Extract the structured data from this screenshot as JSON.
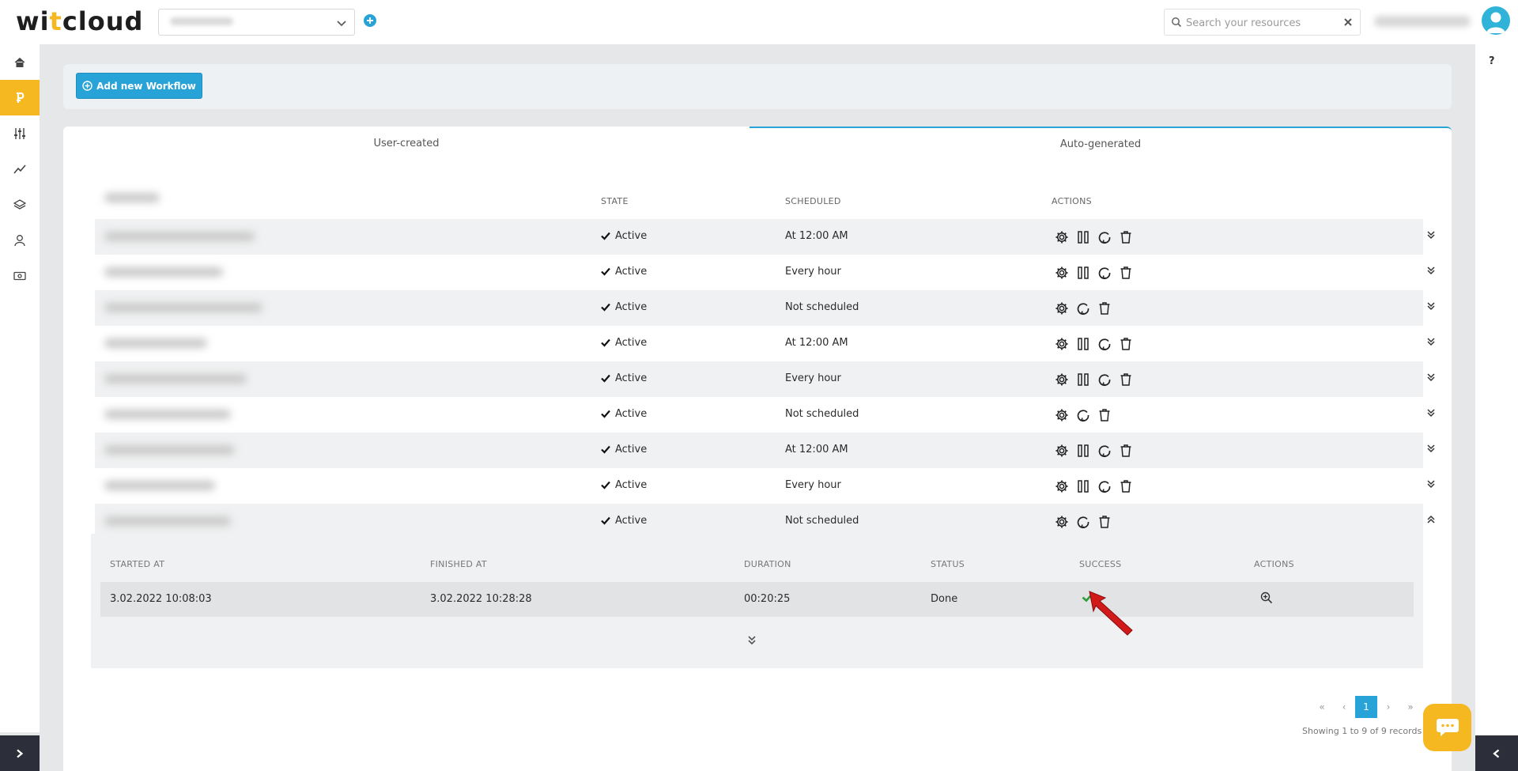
{
  "app": {
    "logo_text_a": "wi",
    "logo_text_b": "t",
    "logo_text_c": "cloud"
  },
  "search": {
    "placeholder": "Search your resources"
  },
  "help_label": "?",
  "toolbar": {
    "add_label": "Add new Workflow"
  },
  "tabs": [
    {
      "label": "User-created"
    },
    {
      "label": "Auto-generated"
    }
  ],
  "table": {
    "headers": {
      "state": "STATE",
      "scheduled": "SCHEDULED",
      "actions": "ACTIONS"
    },
    "rows": [
      {
        "state": "Active",
        "scheduled": "At 12:00 AM",
        "actions": [
          "settings",
          "pause",
          "rerun",
          "delete"
        ]
      },
      {
        "state": "Active",
        "scheduled": "Every hour",
        "actions": [
          "settings",
          "pause",
          "rerun",
          "delete"
        ]
      },
      {
        "state": "Active",
        "scheduled": "Not scheduled",
        "actions": [
          "settings",
          "rerun",
          "delete"
        ]
      },
      {
        "state": "Active",
        "scheduled": "At 12:00 AM",
        "actions": [
          "settings",
          "pause",
          "rerun",
          "delete"
        ]
      },
      {
        "state": "Active",
        "scheduled": "Every hour",
        "actions": [
          "settings",
          "pause",
          "rerun",
          "delete"
        ]
      },
      {
        "state": "Active",
        "scheduled": "Not scheduled",
        "actions": [
          "settings",
          "rerun",
          "delete"
        ]
      },
      {
        "state": "Active",
        "scheduled": "At 12:00 AM",
        "actions": [
          "settings",
          "pause",
          "rerun",
          "delete"
        ]
      },
      {
        "state": "Active",
        "scheduled": "Every hour",
        "actions": [
          "settings",
          "pause",
          "rerun",
          "delete"
        ]
      },
      {
        "state": "Active",
        "scheduled": "Not scheduled",
        "actions": [
          "settings",
          "rerun",
          "delete"
        ]
      }
    ]
  },
  "runs": {
    "headers": {
      "started": "STARTED AT",
      "finished": "FINISHED AT",
      "duration": "DURATION",
      "status": "STATUS",
      "success": "SUCCESS",
      "actions": "ACTIONS"
    },
    "rows": [
      {
        "started": "3.02.2022 10:08:03",
        "finished": "3.02.2022 10:28:28",
        "duration": "00:20:25",
        "status": "Done",
        "success": true
      }
    ]
  },
  "pagination": {
    "first": "«",
    "prev": "‹",
    "current": "1",
    "next": "›",
    "last": "»",
    "summary": "Showing 1 to 9 of 9 records"
  },
  "colors": {
    "accent": "#27a3d8",
    "brand_yellow": "#f6b820",
    "success": "#2e9e3a",
    "annotation": "#d11a1a"
  },
  "icons": {
    "sidebar": [
      "home-icon",
      "workflow-icon",
      "sliders-icon",
      "analytics-icon",
      "layers-icon",
      "user-icon",
      "billing-icon"
    ]
  }
}
